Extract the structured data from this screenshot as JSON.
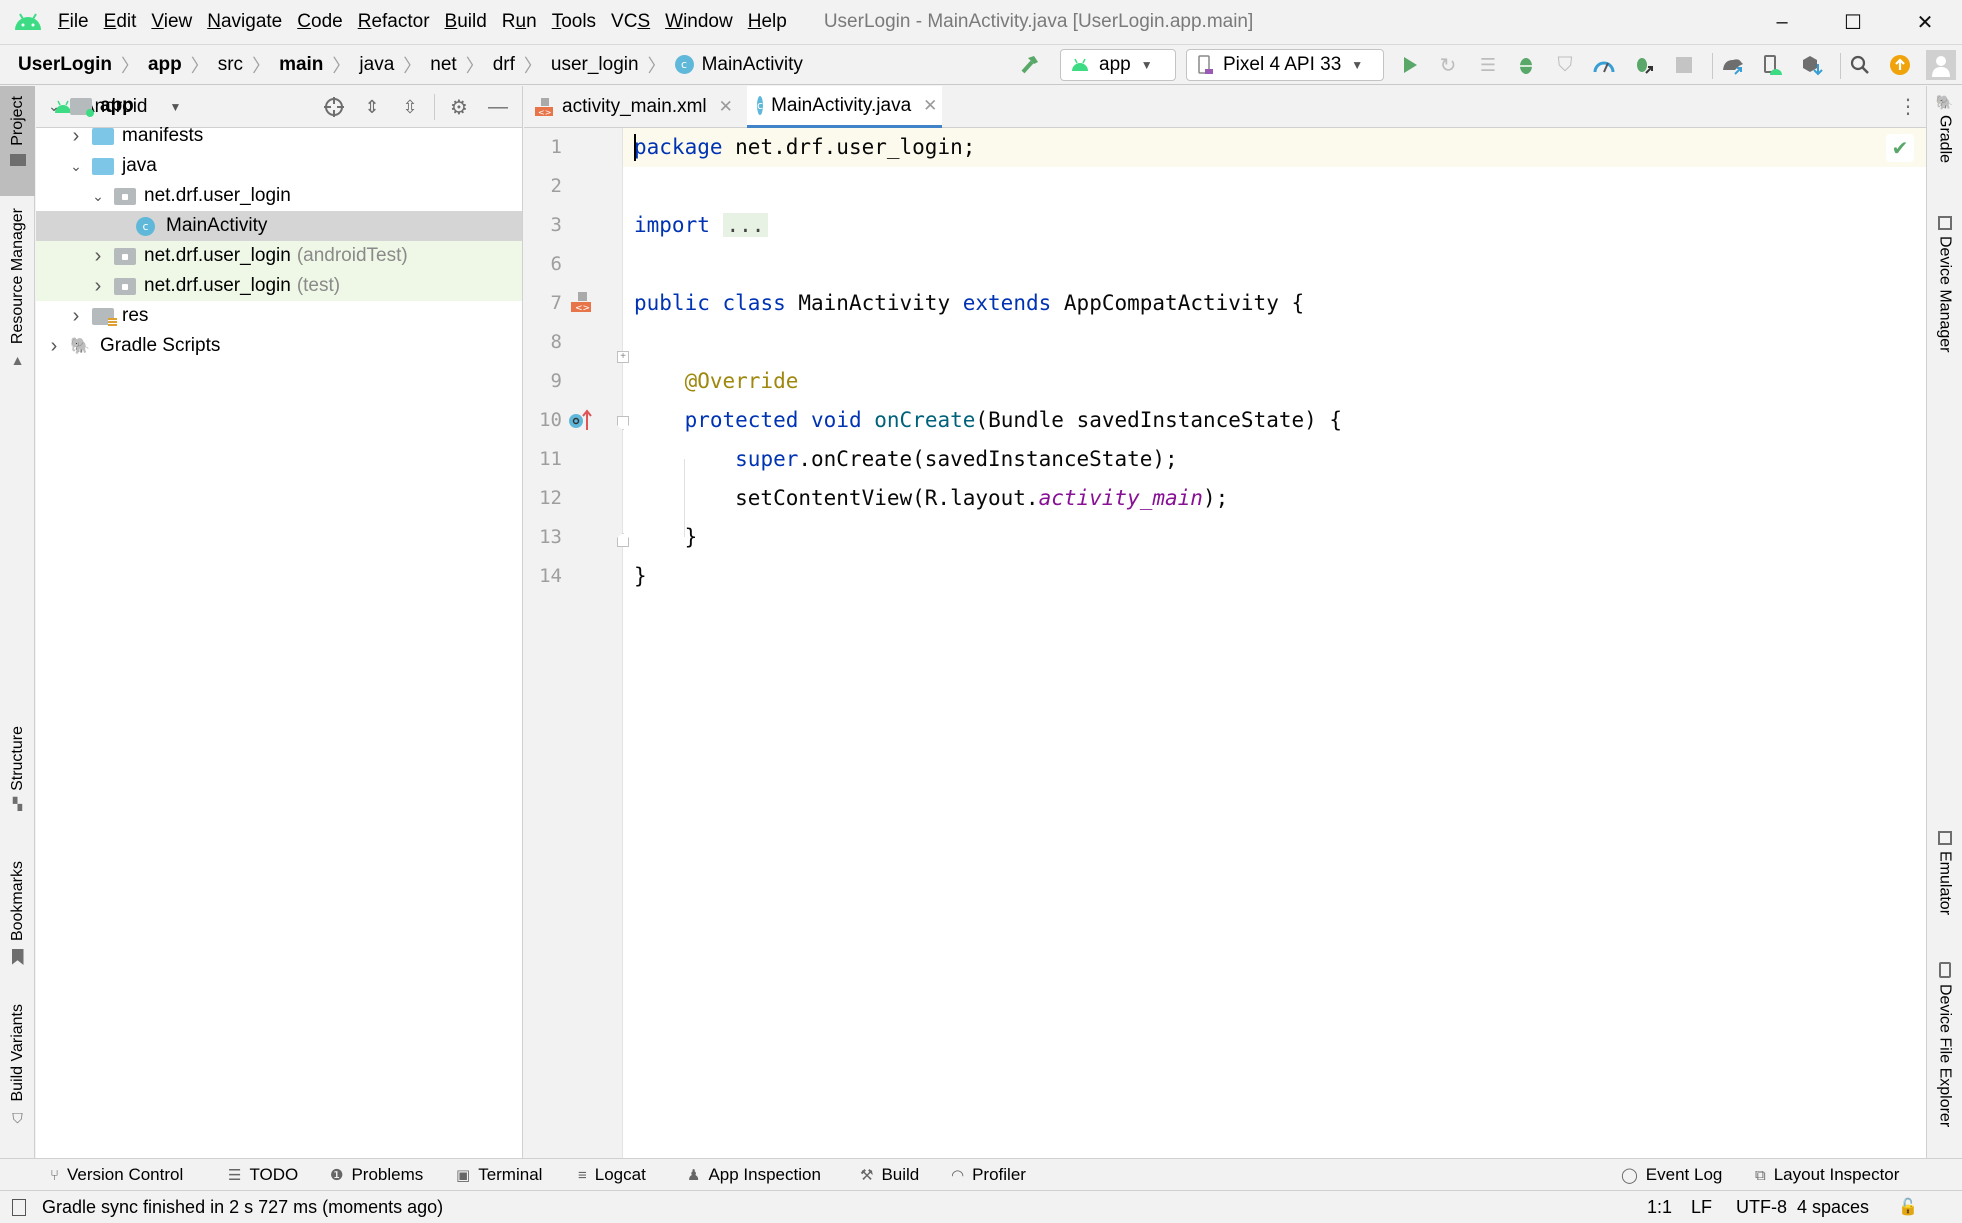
{
  "app": {
    "window_title": "UserLogin - MainActivity.java [UserLogin.app.main]",
    "brand_color": "#3ddc84",
    "accent_color": "#4083c9"
  },
  "menu": [
    {
      "label": "File",
      "mnemonic": "F",
      "rest": "ile"
    },
    {
      "label": "Edit",
      "mnemonic": "E",
      "rest": "dit"
    },
    {
      "label": "View",
      "mnemonic": "V",
      "rest": "iew"
    },
    {
      "label": "Navigate",
      "mnemonic": "N",
      "rest": "avigate"
    },
    {
      "label": "Code",
      "mnemonic": "C",
      "rest": "ode"
    },
    {
      "label": "Refactor",
      "mnemonic": "R",
      "rest": "efactor"
    },
    {
      "label": "Build",
      "mnemonic": "B",
      "rest": "uild"
    },
    {
      "label": "Run",
      "pre": "R",
      "mnemonic": "u",
      "rest": "n"
    },
    {
      "label": "Tools",
      "mnemonic": "T",
      "rest": "ools"
    },
    {
      "label": "VCS",
      "pre": "VC",
      "mnemonic": "S",
      "rest": ""
    },
    {
      "label": "Window",
      "mnemonic": "W",
      "rest": "indow"
    },
    {
      "label": "Help",
      "mnemonic": "H",
      "rest": "elp"
    }
  ],
  "window_controls": {
    "minimize": "–",
    "maximize": "☐",
    "close": "✕"
  },
  "breadcrumb": [
    {
      "label": "UserLogin",
      "bold": true
    },
    {
      "label": "app",
      "bold": true
    },
    {
      "label": "src",
      "bold": false
    },
    {
      "label": "main",
      "bold": true
    },
    {
      "label": "java",
      "bold": false
    },
    {
      "label": "net",
      "bold": false
    },
    {
      "label": "drf",
      "bold": false
    },
    {
      "label": "user_login",
      "bold": false
    },
    {
      "label": "MainActivity",
      "bold": false,
      "icon": "class-icon"
    }
  ],
  "toolbar": {
    "run_config": "app",
    "device": "Pixel 4 API 33",
    "icons": [
      "hammer-build-icon",
      "run-icon",
      "apply-changes-icon",
      "apply-code-changes-icon",
      "debug-icon",
      "run-with-coverage-icon",
      "profile-icon",
      "attach-debugger-icon",
      "stop-icon",
      "gradle-sync-icon",
      "device-manager-icon",
      "sdk-manager-icon",
      "search-icon",
      "update-icon",
      "account-icon"
    ]
  },
  "left_stripe": {
    "top": [
      {
        "label": "Project",
        "active": true
      },
      {
        "label": "Resource Manager",
        "active": false
      }
    ],
    "bottom": [
      {
        "label": "Structure"
      },
      {
        "label": "Bookmarks"
      },
      {
        "label": "Build Variants"
      }
    ]
  },
  "right_stripe": {
    "top": [
      {
        "label": "Gradle"
      },
      {
        "label": "Device Manager"
      }
    ],
    "bottom": [
      {
        "label": "Emulator"
      },
      {
        "label": "Device File Explorer"
      }
    ]
  },
  "project_panel": {
    "view_mode": "Android",
    "tree": [
      {
        "label": "app",
        "suffix": "",
        "level": 0,
        "expanded": true,
        "type": "module",
        "bold": true
      },
      {
        "label": "manifests",
        "suffix": "",
        "level": 1,
        "expanded": false,
        "type": "folder"
      },
      {
        "label": "java",
        "suffix": "",
        "level": 1,
        "expanded": true,
        "type": "folder"
      },
      {
        "label": "net.drf.user_login",
        "suffix": "",
        "level": 2,
        "expanded": true,
        "type": "package"
      },
      {
        "label": "MainActivity",
        "suffix": "",
        "level": 3,
        "type": "class",
        "selected": true
      },
      {
        "label": "net.drf.user_login",
        "suffix": "(androidTest)",
        "level": 2,
        "expanded": false,
        "type": "package",
        "test": true
      },
      {
        "label": "net.drf.user_login",
        "suffix": "(test)",
        "level": 2,
        "expanded": false,
        "type": "package",
        "test": true
      },
      {
        "label": "res",
        "suffix": "",
        "level": 1,
        "expanded": false,
        "type": "res"
      },
      {
        "label": "Gradle Scripts",
        "suffix": "",
        "level": 0,
        "expanded": false,
        "type": "gradle"
      }
    ]
  },
  "editor": {
    "tabs": [
      {
        "label": "activity_main.xml",
        "active": false,
        "icon": "xml-layout-icon"
      },
      {
        "label": "MainActivity.java",
        "active": true,
        "icon": "class-icon"
      }
    ],
    "inspection_status": "no-problems",
    "lines": [
      {
        "n": "1",
        "tokens": [
          [
            "kw",
            "package"
          ],
          [
            "",
            "  net.drf.user_login;"
          ]
        ]
      },
      {
        "n": "2",
        "tokens": []
      },
      {
        "n": "3",
        "tokens": [
          [
            "kw",
            "import"
          ],
          [
            "",
            " "
          ],
          [
            "fold",
            "..."
          ]
        ]
      },
      {
        "n": "6",
        "tokens": []
      },
      {
        "n": "7",
        "tokens": [
          [
            "kw",
            "public"
          ],
          [
            "",
            " "
          ],
          [
            "kw",
            "class"
          ],
          [
            "",
            " MainActivity "
          ],
          [
            "kw",
            "extends"
          ],
          [
            "",
            " AppCompatActivity {"
          ]
        ]
      },
      {
        "n": "8",
        "tokens": []
      },
      {
        "n": "9",
        "tokens": [
          [
            "",
            "    "
          ],
          [
            "ann",
            "@Override"
          ]
        ]
      },
      {
        "n": "10",
        "tokens": [
          [
            "",
            "    "
          ],
          [
            "kw",
            "protected"
          ],
          [
            "",
            " "
          ],
          [
            "kw",
            "void"
          ],
          [
            "",
            " "
          ],
          [
            "fn",
            "onCreate"
          ],
          [
            "",
            "(Bundle savedInstanceState) {"
          ]
        ]
      },
      {
        "n": "11",
        "tokens": [
          [
            "",
            "        "
          ],
          [
            "kw",
            "super"
          ],
          [
            "",
            ".onCreate(savedInstanceState);"
          ]
        ]
      },
      {
        "n": "12",
        "tokens": [
          [
            "",
            "        setContentView(R.layout."
          ],
          [
            "it",
            "activity_main"
          ],
          [
            "",
            ");"
          ]
        ]
      },
      {
        "n": "13",
        "tokens": [
          [
            "",
            "    }"
          ]
        ]
      },
      {
        "n": "14",
        "tokens": [
          [
            "",
            "}"
          ]
        ]
      }
    ]
  },
  "tool_windows": {
    "left": [
      {
        "label": "Version Control",
        "icon": "⑂"
      },
      {
        "label": "TODO",
        "icon": "☰"
      },
      {
        "label": "Problems",
        "icon": "❶"
      },
      {
        "label": "Terminal",
        "icon": "▣"
      },
      {
        "label": "Logcat",
        "icon": "≡"
      },
      {
        "label": "App Inspection",
        "icon": "♟"
      },
      {
        "label": "Build",
        "icon": "⚒"
      },
      {
        "label": "Profiler",
        "icon": "◠"
      }
    ],
    "right": [
      {
        "label": "Event Log",
        "icon": "◯"
      },
      {
        "label": "Layout Inspector",
        "icon": "⧉"
      }
    ]
  },
  "status": {
    "message": "Gradle sync finished in 2 s 727 ms (moments ago)",
    "position": "1:1",
    "line_separator": "LF",
    "encoding": "UTF-8",
    "indent": "4 spaces"
  }
}
